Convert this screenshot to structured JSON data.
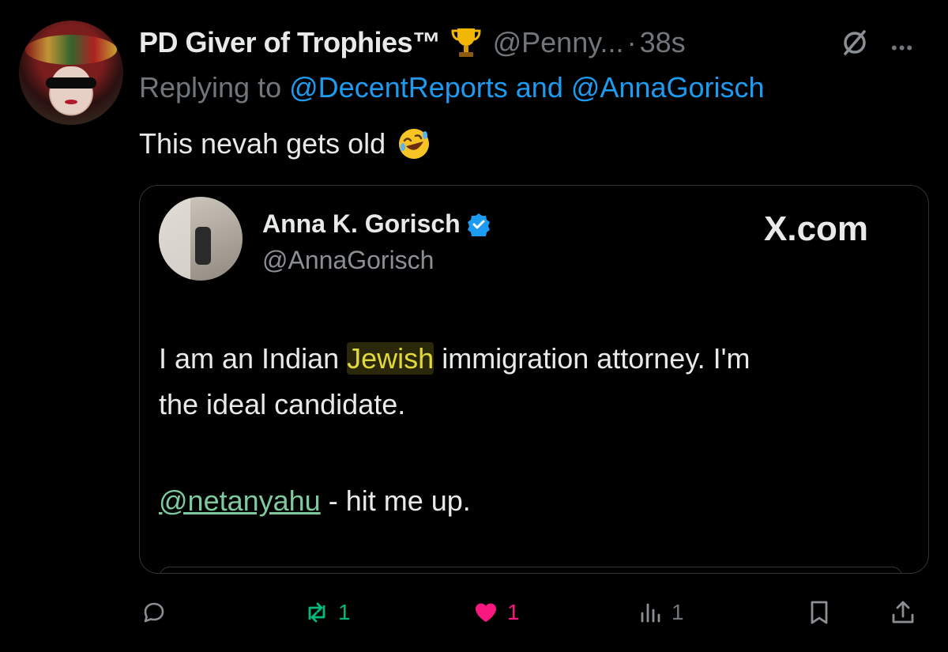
{
  "tweet": {
    "author_name": "PD Giver of Trophies™",
    "handle": "@Penny...",
    "separator": "·",
    "time": "38s",
    "replying_prefix": "Replying to",
    "replying_to": "@DecentReports and @AnnaGorisch",
    "text": "This nevah gets old"
  },
  "quote": {
    "author_name": "Anna K. Gorisch",
    "handle": "@AnnaGorisch",
    "site": "X.com",
    "line1_before": "I am an Indian ",
    "line1_highlight": "Jewish",
    "line1_after": " immigration attorney. I'm",
    "line2": "the ideal candidate.",
    "mention": "@netanyahu",
    "line3_after": " - hit me up."
  },
  "actions": {
    "retweets": "1",
    "likes": "1",
    "views": "1"
  },
  "colors": {
    "background": "#000000",
    "link": "#1d9bf0",
    "retweet": "#00ba7c",
    "like": "#f91880",
    "muted": "#71767b",
    "highlight": "#e1d83a",
    "mention": "#7fc9a0"
  },
  "icons": [
    "trophy-icon",
    "laughing-emoji-icon",
    "verified-badge-icon",
    "no-sign-icon",
    "more-icon",
    "reply-icon",
    "retweet-icon",
    "heart-icon",
    "views-icon",
    "bookmark-icon",
    "share-icon"
  ]
}
